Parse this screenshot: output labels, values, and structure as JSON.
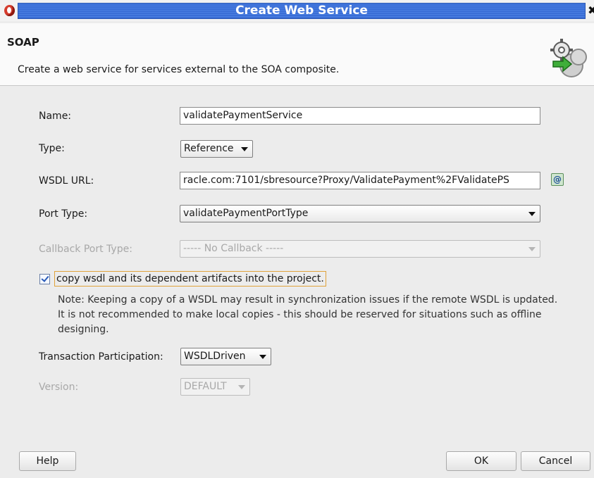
{
  "window": {
    "title": "Create Web Service"
  },
  "header": {
    "title": "SOAP",
    "description": "Create a web service for services external to the SOA composite."
  },
  "form": {
    "name": {
      "label": "Name:",
      "value": "validatePaymentService"
    },
    "type": {
      "label": "Type:",
      "value": "Reference"
    },
    "wsdl_url": {
      "label": "WSDL URL:",
      "value": "racle.com:7101/sbresource?Proxy/ValidatePayment%2FValidatePS"
    },
    "port_type": {
      "label": "Port Type:",
      "value": "validatePaymentPortType"
    },
    "callback_port_type": {
      "label": "Callback Port Type:",
      "value": "----- No Callback -----",
      "enabled": false
    },
    "copy_wsdl": {
      "label": "copy wsdl and its dependent artifacts into the project.",
      "checked": true
    },
    "note": "Note: Keeping a copy of a WSDL may result in synchronization issues if the remote WSDL is updated. It is not recommended to make local copies - this should be reserved for situations such as offline designing.",
    "transaction": {
      "label": "Transaction Participation:",
      "value": "WSDLDriven"
    },
    "version": {
      "label": "Version:",
      "value": "DEFAULT",
      "enabled": false
    }
  },
  "buttons": {
    "help": "Help",
    "ok": "OK",
    "cancel": "Cancel"
  },
  "icons": {
    "app": "oracle-logo-icon",
    "close": "close-icon",
    "wizard": "gear-service-icon",
    "browse": "browse-wsdl-icon"
  }
}
